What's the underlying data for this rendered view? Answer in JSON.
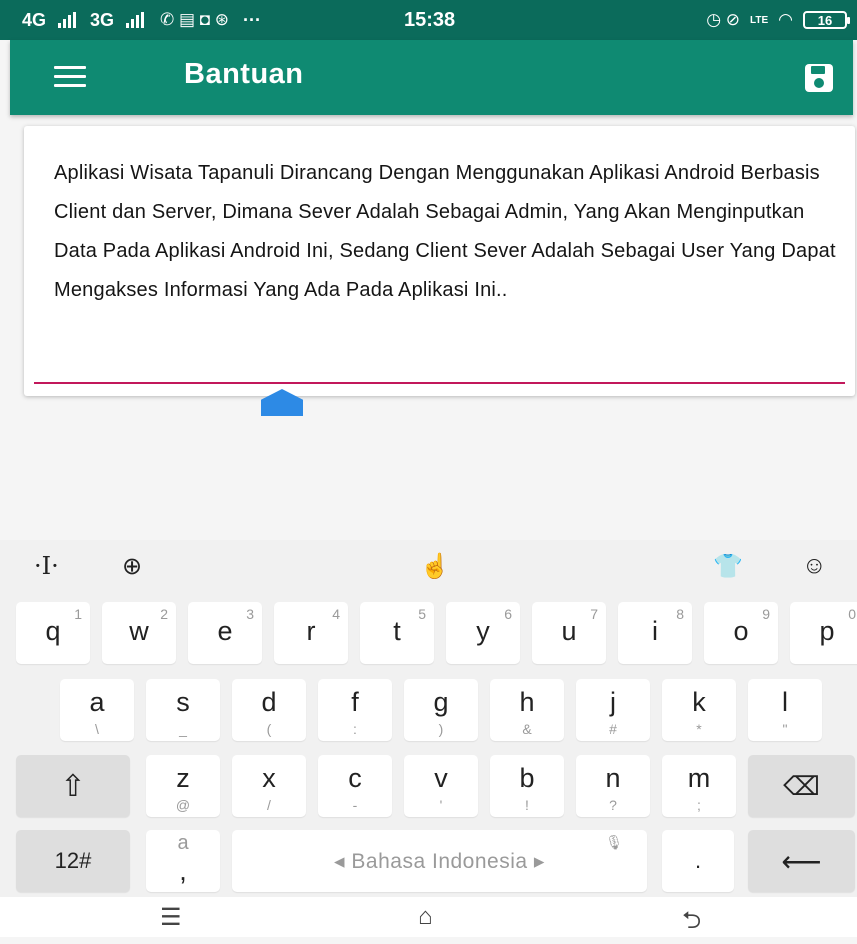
{
  "status_bar": {
    "net1": "4G",
    "net2": "3G",
    "notif_icons": "✆ ▤ ◘ ⊛",
    "more": "···",
    "time": "15:38",
    "right_icons": "◷ ⊘",
    "volte": "LTE",
    "battery": "16"
  },
  "app_bar": {
    "title": "Bantuan",
    "menu_icon": "hamburger-icon",
    "save_icon": "save-icon",
    "color": "#0f8a72"
  },
  "content": {
    "text": "Aplikasi Wisata Tapanuli Dirancang Dengan Menggunakan Aplikasi Android Berbasis Client dan Server, Dimana Sever Adalah Sebagai Admin, Yang Akan Menginputkan Data Pada Aplikasi Android Ini, Sedang Client Sever Adalah Sebagai User Yang Dapat Mengakses Informasi Yang Ada Pada Aplikasi Ini..",
    "underline_color": "#c2185b",
    "handle_color": "#2d8ae5"
  },
  "keyboard": {
    "toolbar": {
      "cursor": "·I·",
      "globe": "⊕",
      "swipe": "☝",
      "theme": "👕",
      "emoji": "☺"
    },
    "row1": [
      {
        "main": "q",
        "hint": "1"
      },
      {
        "main": "w",
        "hint": "2"
      },
      {
        "main": "e",
        "hint": "3"
      },
      {
        "main": "r",
        "hint": "4"
      },
      {
        "main": "t",
        "hint": "5"
      },
      {
        "main": "y",
        "hint": "6"
      },
      {
        "main": "u",
        "hint": "7"
      },
      {
        "main": "i",
        "hint": "8"
      },
      {
        "main": "o",
        "hint": "9"
      },
      {
        "main": "p",
        "hint": "0"
      }
    ],
    "row2": [
      {
        "main": "a",
        "sub": "\\"
      },
      {
        "main": "s",
        "sub": "_"
      },
      {
        "main": "d",
        "sub": "("
      },
      {
        "main": "f",
        "sub": ":"
      },
      {
        "main": "g",
        "sub": ")"
      },
      {
        "main": "h",
        "sub": "&"
      },
      {
        "main": "j",
        "sub": "#"
      },
      {
        "main": "k",
        "sub": "*"
      },
      {
        "main": "l",
        "sub": "\""
      }
    ],
    "row3": [
      {
        "main": "z",
        "sub": "@"
      },
      {
        "main": "x",
        "sub": "/"
      },
      {
        "main": "c",
        "sub": "-"
      },
      {
        "main": "v",
        "sub": "'"
      },
      {
        "main": "b",
        "sub": "!"
      },
      {
        "main": "n",
        "sub": "?"
      },
      {
        "main": "m",
        "sub": ";"
      }
    ],
    "shift": "⇧",
    "backspace": "⌫",
    "symbols": "12#",
    "comma_top": "a",
    "comma": ",",
    "space_label": "◂ Bahasa Indonesia ▸",
    "mic_icon": "🎙",
    "period": ".",
    "enter": "⟵"
  },
  "nav_bar": {
    "recent": "☰",
    "home": "⌂",
    "back": "⮌"
  }
}
